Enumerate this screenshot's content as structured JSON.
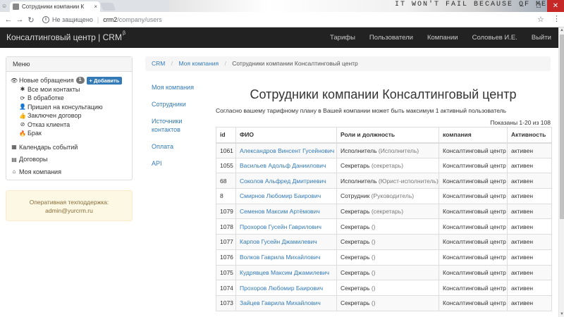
{
  "browser": {
    "tab_title": "Сотрудники компании К",
    "tab_close": "×",
    "security_label": "Не защищено",
    "url_host": "crm2",
    "url_path": "/company/users",
    "banner_text": "IT WON'T FAIL BECAUSE OF ME"
  },
  "app": {
    "brand": "Консалтинговый центр | CRM",
    "brand_sup": "β",
    "nav": [
      "Тарифы",
      "Пользователи",
      "Компании",
      "Соловьев И.Е.",
      "Выйти"
    ]
  },
  "sidebar": {
    "heading": "Меню",
    "new_requests": {
      "label": "Новые обращения",
      "badge": "1",
      "add_button": "+ Добавить"
    },
    "sub_items": [
      {
        "icon": "asterisk-icon",
        "label": "Все мои контакты"
      },
      {
        "icon": "refresh-icon",
        "label": "В обработке"
      },
      {
        "icon": "user-icon",
        "label": "Пришел на консультацию"
      },
      {
        "icon": "thumbs-up-icon",
        "label": "Заключен договор"
      },
      {
        "icon": "ban-icon",
        "label": "Отказ клиента"
      },
      {
        "icon": "fire-icon",
        "label": "Брак"
      }
    ],
    "items": [
      {
        "icon": "calendar-icon",
        "label": "Календарь событий"
      },
      {
        "icon": "file-icon",
        "label": "Договоры"
      },
      {
        "icon": "home-icon",
        "label": "Моя компания"
      }
    ]
  },
  "support": {
    "title": "Оперативная техподдержка:",
    "email": "admin@yurcrm.ru"
  },
  "breadcrumb": {
    "items": [
      "CRM",
      "Моя компания"
    ],
    "active": "Сотрудники компании Консалтинговый центр",
    "separator": "/"
  },
  "subnav": [
    "Моя компания",
    "Сотрудники",
    "Источники контактов",
    "Оплата",
    "API"
  ],
  "main": {
    "title": "Сотрудники компании Консалтинговый центр",
    "plan_text": "Согласно вашему тарифному плану в Вашей компании может быть максимум 1 активный пользователь",
    "shown_text": "Показаны 1-20 из 108"
  },
  "table": {
    "headers": [
      "id",
      "ФИО",
      "Роли и должность",
      "компания",
      "Активность"
    ],
    "rows": [
      {
        "id": "1061",
        "name": "Александров Винсент Гусейнович",
        "role": "Исполнитель",
        "position": "(Исполнитель)",
        "company": "Консалтинговый центр",
        "status": "активен"
      },
      {
        "id": "1055",
        "name": "Васильев Адольф Даниилович",
        "role": "Секретарь",
        "position": "(секретарь)",
        "company": "Консалтинговый центр",
        "status": "активен"
      },
      {
        "id": "68",
        "name": "Соколов Альфред Дмитриевич",
        "role": "Исполнитель",
        "position": "(Юрист-исполнитель)",
        "company": "Консалтинговый центр",
        "status": "активен"
      },
      {
        "id": "8",
        "name": "Смирнов Любомир Баирович",
        "role": "Сотрудник",
        "position": "(Руководитель)",
        "company": "Консалтинговый центр",
        "status": "активен"
      },
      {
        "id": "1079",
        "name": "Семенов Максим Артёмович",
        "role": "Секретарь",
        "position": "(секретарь)",
        "company": "Консалтинговый центр",
        "status": "активен"
      },
      {
        "id": "1078",
        "name": "Прохоров Гусейн Гаврилович",
        "role": "Секретарь",
        "position": "()",
        "company": "Консалтинговый центр",
        "status": "активен"
      },
      {
        "id": "1077",
        "name": "Карпов Гусейн Джамилевич",
        "role": "Секретарь",
        "position": "()",
        "company": "Консалтинговый центр",
        "status": "активен"
      },
      {
        "id": "1076",
        "name": "Волков Гаврила Михайлович",
        "role": "Секретарь",
        "position": "()",
        "company": "Консалтинговый центр",
        "status": "активен"
      },
      {
        "id": "1075",
        "name": "Кудрявцев Максим Джамилевич",
        "role": "Секретарь",
        "position": "()",
        "company": "Консалтинговый центр",
        "status": "активен"
      },
      {
        "id": "1074",
        "name": "Прохоров Любомир Баирович",
        "role": "Секретарь",
        "position": "()",
        "company": "Консалтинговый центр",
        "status": "активен"
      },
      {
        "id": "1073",
        "name": "Зайцев Гаврила Михайлович",
        "role": "Секретарь",
        "position": "()",
        "company": "Консалтинговый центр",
        "status": "активен"
      }
    ]
  }
}
